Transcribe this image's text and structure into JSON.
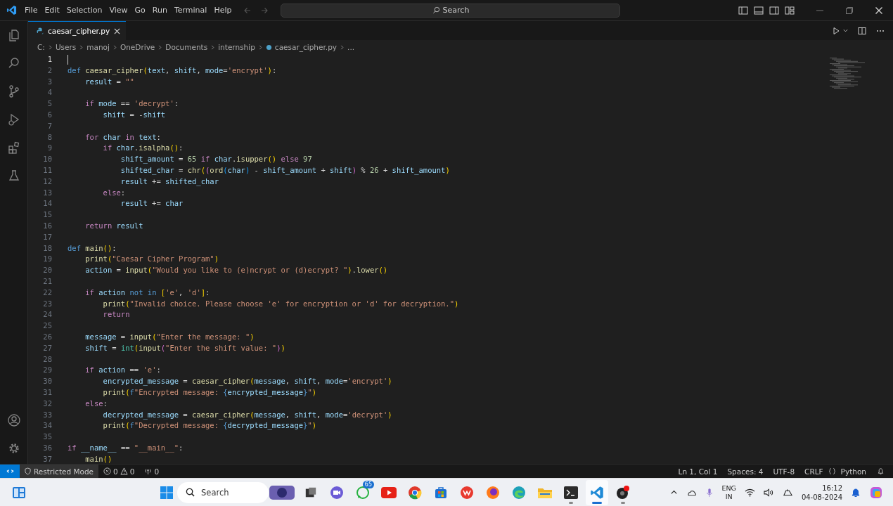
{
  "title_bar": {
    "menu": [
      "File",
      "Edit",
      "Selection",
      "View",
      "Go",
      "Run",
      "Terminal",
      "Help"
    ],
    "search": {
      "placeholder": "Search"
    }
  },
  "tabs": [
    {
      "label": "caesar_cipher.py",
      "selected": true
    }
  ],
  "breadcrumbs": [
    {
      "label": "C:",
      "kind": "folder"
    },
    {
      "label": "Users",
      "kind": "folder"
    },
    {
      "label": "manoj",
      "kind": "folder"
    },
    {
      "label": "OneDrive",
      "kind": "folder"
    },
    {
      "label": "Documents",
      "kind": "folder"
    },
    {
      "label": "internship",
      "kind": "folder"
    },
    {
      "label": "caesar_cipher.py",
      "kind": "file"
    },
    {
      "label": "...",
      "kind": "more"
    }
  ],
  "editor": {
    "lines": [
      {
        "number": "1",
        "active": true
      },
      {
        "number": "2",
        "active": false,
        "tokens": [
          {
            "kind": "keyword",
            "text": "def"
          },
          {
            "kind": "function",
            "text": " caesar_cipher"
          },
          {
            "kind": "bracket",
            "text": "("
          },
          {
            "kind": "variable",
            "text": "text"
          },
          {
            "kind": "punct",
            "text": ", "
          },
          {
            "kind": "variable",
            "text": "shift"
          },
          {
            "kind": "punct",
            "text": ", "
          },
          {
            "kind": "variable",
            "text": "mode"
          },
          {
            "kind": "punct",
            "text": "="
          },
          {
            "kind": "string",
            "text": "'encrypt'"
          },
          {
            "kind": "bracket",
            "text": ")"
          },
          {
            "kind": "punct",
            "text": ":"
          }
        ]
      },
      {
        "number": "3",
        "active": false,
        "tokens": [
          {
            "kind": "variable",
            "text": "    result"
          },
          {
            "kind": "punct",
            "text": " = "
          },
          {
            "kind": "string",
            "text": "\"\""
          }
        ]
      },
      {
        "number": "4",
        "active": false
      },
      {
        "number": "5",
        "active": false,
        "tokens": [
          {
            "kind": "control",
            "text": "    if"
          },
          {
            "kind": "variable",
            "text": " mode"
          },
          {
            "kind": "punct",
            "text": " == "
          },
          {
            "kind": "string",
            "text": "'decrypt'"
          },
          {
            "kind": "punct",
            "text": ":"
          }
        ]
      },
      {
        "number": "6",
        "active": false,
        "tokens": [
          {
            "kind": "variable",
            "text": "        shift"
          },
          {
            "kind": "punct",
            "text": " = -"
          },
          {
            "kind": "variable",
            "text": "shift"
          }
        ]
      },
      {
        "number": "7",
        "active": false
      },
      {
        "number": "8",
        "active": false,
        "tokens": [
          {
            "kind": "control",
            "text": "    for"
          },
          {
            "kind": "variable",
            "text": " char"
          },
          {
            "kind": "control",
            "text": " in"
          },
          {
            "kind": "variable",
            "text": " text"
          },
          {
            "kind": "punct",
            "text": ":"
          }
        ]
      },
      {
        "number": "9",
        "active": false,
        "tokens": [
          {
            "kind": "control",
            "text": "        if"
          },
          {
            "kind": "variable",
            "text": " char"
          },
          {
            "kind": "punct",
            "text": "."
          },
          {
            "kind": "function",
            "text": "isalpha"
          },
          {
            "kind": "bracket",
            "text": "()"
          },
          {
            "kind": "punct",
            "text": ":"
          }
        ]
      },
      {
        "number": "10",
        "active": false,
        "tokens": [
          {
            "kind": "variable",
            "text": "            shift_amount"
          },
          {
            "kind": "punct",
            "text": " = "
          },
          {
            "kind": "number",
            "text": "65"
          },
          {
            "kind": "control",
            "text": " if"
          },
          {
            "kind": "variable",
            "text": " char"
          },
          {
            "kind": "punct",
            "text": "."
          },
          {
            "kind": "function",
            "text": "isupper"
          },
          {
            "kind": "bracket",
            "text": "()"
          },
          {
            "kind": "control",
            "text": " else"
          },
          {
            "kind": "number",
            "text": " 97"
          }
        ]
      },
      {
        "number": "11",
        "active": false,
        "tokens": [
          {
            "kind": "variable",
            "text": "            shifted_char"
          },
          {
            "kind": "punct",
            "text": " = "
          },
          {
            "kind": "function",
            "text": "chr"
          },
          {
            "kind": "bracket",
            "text": "("
          },
          {
            "kind": "bracket2",
            "text": "("
          },
          {
            "kind": "function",
            "text": "ord"
          },
          {
            "kind": "bracket3",
            "text": "("
          },
          {
            "kind": "variable",
            "text": "char"
          },
          {
            "kind": "bracket3",
            "text": ")"
          },
          {
            "kind": "punct",
            "text": " - "
          },
          {
            "kind": "variable",
            "text": "shift_amount"
          },
          {
            "kind": "punct",
            "text": " + "
          },
          {
            "kind": "variable",
            "text": "shift"
          },
          {
            "kind": "bracket2",
            "text": ")"
          },
          {
            "kind": "punct",
            "text": " % "
          },
          {
            "kind": "number",
            "text": "26"
          },
          {
            "kind": "punct",
            "text": " + "
          },
          {
            "kind": "variable",
            "text": "shift_amount"
          },
          {
            "kind": "bracket",
            "text": ")"
          }
        ]
      },
      {
        "number": "12",
        "active": false,
        "tokens": [
          {
            "kind": "variable",
            "text": "            result"
          },
          {
            "kind": "punct",
            "text": " += "
          },
          {
            "kind": "variable",
            "text": "shifted_char"
          }
        ]
      },
      {
        "number": "13",
        "active": false,
        "tokens": [
          {
            "kind": "control",
            "text": "        else"
          },
          {
            "kind": "punct",
            "text": ":"
          }
        ]
      },
      {
        "number": "14",
        "active": false,
        "tokens": [
          {
            "kind": "variable",
            "text": "            result"
          },
          {
            "kind": "punct",
            "text": " += "
          },
          {
            "kind": "variable",
            "text": "char"
          }
        ]
      },
      {
        "number": "15",
        "active": false
      },
      {
        "number": "16",
        "active": false,
        "tokens": [
          {
            "kind": "control",
            "text": "    return"
          },
          {
            "kind": "variable",
            "text": " result"
          }
        ]
      },
      {
        "number": "17",
        "active": false
      },
      {
        "number": "18",
        "active": false,
        "tokens": [
          {
            "kind": "keyword",
            "text": "def"
          },
          {
            "kind": "function",
            "text": " main"
          },
          {
            "kind": "bracket",
            "text": "()"
          },
          {
            "kind": "punct",
            "text": ":"
          }
        ]
      },
      {
        "number": "19",
        "active": false,
        "tokens": [
          {
            "kind": "function",
            "text": "    print"
          },
          {
            "kind": "bracket",
            "text": "("
          },
          {
            "kind": "string",
            "text": "\"Caesar Cipher Program\""
          },
          {
            "kind": "bracket",
            "text": ")"
          }
        ]
      },
      {
        "number": "20",
        "active": false,
        "tokens": [
          {
            "kind": "variable",
            "text": "    action"
          },
          {
            "kind": "punct",
            "text": " = "
          },
          {
            "kind": "function",
            "text": "input"
          },
          {
            "kind": "bracket",
            "text": "("
          },
          {
            "kind": "string",
            "text": "\"Would you like to (e)ncrypt or (d)ecrypt? \""
          },
          {
            "kind": "bracket",
            "text": ")"
          },
          {
            "kind": "punct",
            "text": "."
          },
          {
            "kind": "function",
            "text": "lower"
          },
          {
            "kind": "bracket",
            "text": "()"
          }
        ]
      },
      {
        "number": "21",
        "active": false
      },
      {
        "number": "22",
        "active": false,
        "tokens": [
          {
            "kind": "control",
            "text": "    if"
          },
          {
            "kind": "variable",
            "text": " action"
          },
          {
            "kind": "keyword",
            "text": " not in"
          },
          {
            "kind": "bracket",
            "text": " ["
          },
          {
            "kind": "string",
            "text": "'e'"
          },
          {
            "kind": "punct",
            "text": ", "
          },
          {
            "kind": "string",
            "text": "'d'"
          },
          {
            "kind": "bracket",
            "text": "]"
          },
          {
            "kind": "punct",
            "text": ":"
          }
        ]
      },
      {
        "number": "23",
        "active": false,
        "tokens": [
          {
            "kind": "function",
            "text": "        print"
          },
          {
            "kind": "bracket",
            "text": "("
          },
          {
            "kind": "string",
            "text": "\"Invalid choice. Please choose 'e' for encryption or 'd' for decryption.\""
          },
          {
            "kind": "bracket",
            "text": ")"
          }
        ]
      },
      {
        "number": "24",
        "active": false,
        "tokens": [
          {
            "kind": "control",
            "text": "        return"
          }
        ]
      },
      {
        "number": "25",
        "active": false
      },
      {
        "number": "26",
        "active": false,
        "tokens": [
          {
            "kind": "variable",
            "text": "    message"
          },
          {
            "kind": "punct",
            "text": " = "
          },
          {
            "kind": "function",
            "text": "input"
          },
          {
            "kind": "bracket",
            "text": "("
          },
          {
            "kind": "string",
            "text": "\"Enter the message: \""
          },
          {
            "kind": "bracket",
            "text": ")"
          }
        ]
      },
      {
        "number": "27",
        "active": false,
        "tokens": [
          {
            "kind": "variable",
            "text": "    shift"
          },
          {
            "kind": "punct",
            "text": " = "
          },
          {
            "kind": "builtin",
            "text": "int"
          },
          {
            "kind": "bracket",
            "text": "("
          },
          {
            "kind": "function",
            "text": "input"
          },
          {
            "kind": "bracket2",
            "text": "("
          },
          {
            "kind": "string",
            "text": "\"Enter the shift value: \""
          },
          {
            "kind": "bracket2",
            "text": ")"
          },
          {
            "kind": "bracket",
            "text": ")"
          }
        ]
      },
      {
        "number": "28",
        "active": false
      },
      {
        "number": "29",
        "active": false,
        "tokens": [
          {
            "kind": "control",
            "text": "    if"
          },
          {
            "kind": "variable",
            "text": " action"
          },
          {
            "kind": "punct",
            "text": " == "
          },
          {
            "kind": "string",
            "text": "'e'"
          },
          {
            "kind": "punct",
            "text": ":"
          }
        ]
      },
      {
        "number": "30",
        "active": false,
        "tokens": [
          {
            "kind": "variable",
            "text": "        encrypted_message"
          },
          {
            "kind": "punct",
            "text": " = "
          },
          {
            "kind": "function",
            "text": "caesar_cipher"
          },
          {
            "kind": "bracket",
            "text": "("
          },
          {
            "kind": "variable",
            "text": "message"
          },
          {
            "kind": "punct",
            "text": ", "
          },
          {
            "kind": "variable",
            "text": "shift"
          },
          {
            "kind": "punct",
            "text": ", "
          },
          {
            "kind": "variable",
            "text": "mode"
          },
          {
            "kind": "punct",
            "text": "="
          },
          {
            "kind": "string",
            "text": "'encrypt'"
          },
          {
            "kind": "bracket",
            "text": ")"
          }
        ]
      },
      {
        "number": "31",
        "active": false,
        "tokens": [
          {
            "kind": "function",
            "text": "        print"
          },
          {
            "kind": "bracket",
            "text": "("
          },
          {
            "kind": "keyword",
            "text": "f"
          },
          {
            "kind": "string",
            "text": "\"Encrypted message: "
          },
          {
            "kind": "keyword",
            "text": "{"
          },
          {
            "kind": "variable",
            "text": "encrypted_message"
          },
          {
            "kind": "keyword",
            "text": "}"
          },
          {
            "kind": "string",
            "text": "\""
          },
          {
            "kind": "bracket",
            "text": ")"
          }
        ]
      },
      {
        "number": "32",
        "active": false,
        "tokens": [
          {
            "kind": "control",
            "text": "    else"
          },
          {
            "kind": "punct",
            "text": ":"
          }
        ]
      },
      {
        "number": "33",
        "active": false,
        "tokens": [
          {
            "kind": "variable",
            "text": "        decrypted_message"
          },
          {
            "kind": "punct",
            "text": " = "
          },
          {
            "kind": "function",
            "text": "caesar_cipher"
          },
          {
            "kind": "bracket",
            "text": "("
          },
          {
            "kind": "variable",
            "text": "message"
          },
          {
            "kind": "punct",
            "text": ", "
          },
          {
            "kind": "variable",
            "text": "shift"
          },
          {
            "kind": "punct",
            "text": ", "
          },
          {
            "kind": "variable",
            "text": "mode"
          },
          {
            "kind": "punct",
            "text": "="
          },
          {
            "kind": "string",
            "text": "'decrypt'"
          },
          {
            "kind": "bracket",
            "text": ")"
          }
        ]
      },
      {
        "number": "34",
        "active": false,
        "tokens": [
          {
            "kind": "function",
            "text": "        print"
          },
          {
            "kind": "bracket",
            "text": "("
          },
          {
            "kind": "keyword",
            "text": "f"
          },
          {
            "kind": "string",
            "text": "\"Decrypted message: "
          },
          {
            "kind": "keyword",
            "text": "{"
          },
          {
            "kind": "variable",
            "text": "decrypted_message"
          },
          {
            "kind": "keyword",
            "text": "}"
          },
          {
            "kind": "string",
            "text": "\""
          },
          {
            "kind": "bracket",
            "text": ")"
          }
        ]
      },
      {
        "number": "35",
        "active": false
      },
      {
        "number": "36",
        "active": false,
        "tokens": [
          {
            "kind": "control",
            "text": "if"
          },
          {
            "kind": "variable",
            "text": " __name__"
          },
          {
            "kind": "punct",
            "text": " == "
          },
          {
            "kind": "string",
            "text": "\"__main__\""
          },
          {
            "kind": "punct",
            "text": ":"
          }
        ]
      },
      {
        "number": "37",
        "active": false,
        "tokens": [
          {
            "kind": "function",
            "text": "    main"
          },
          {
            "kind": "bracket",
            "text": "()"
          }
        ]
      }
    ]
  },
  "status_bar": {
    "mode": "Restricted Mode",
    "errors": "0",
    "warnings": "0",
    "ports": "0",
    "items": [
      "Ln 1, Col 1",
      "Spaces: 4",
      "UTF-8",
      "CRLF",
      "Python"
    ]
  },
  "taskbar": {
    "search": {
      "placeholder": "Search"
    },
    "apps": [
      {
        "kind": "thumbnail",
        "running": false,
        "selected": false
      },
      {
        "kind": "window",
        "running": false,
        "selected": false
      },
      {
        "kind": "videochat",
        "running": false,
        "selected": false
      },
      {
        "kind": "whatsapp",
        "running": false,
        "selected": false,
        "badge": "65"
      },
      {
        "kind": "youtube",
        "running": false,
        "selected": false
      },
      {
        "kind": "chrome",
        "running": false,
        "selected": false
      },
      {
        "kind": "store",
        "running": false,
        "selected": false
      },
      {
        "kind": "wps",
        "running": false,
        "selected": false
      },
      {
        "kind": "firefox",
        "running": false,
        "selected": false
      },
      {
        "kind": "edge",
        "running": false,
        "selected": false
      },
      {
        "kind": "explorer",
        "running": false,
        "selected": false
      },
      {
        "kind": "terminal",
        "running": true,
        "selected": false
      },
      {
        "kind": "vscode",
        "running": true,
        "selected": true
      },
      {
        "kind": "recorder",
        "running": true,
        "selected": false
      }
    ],
    "language": [
      "ENG",
      "IN"
    ],
    "time": "16:12",
    "date": "04-08-2024"
  }
}
